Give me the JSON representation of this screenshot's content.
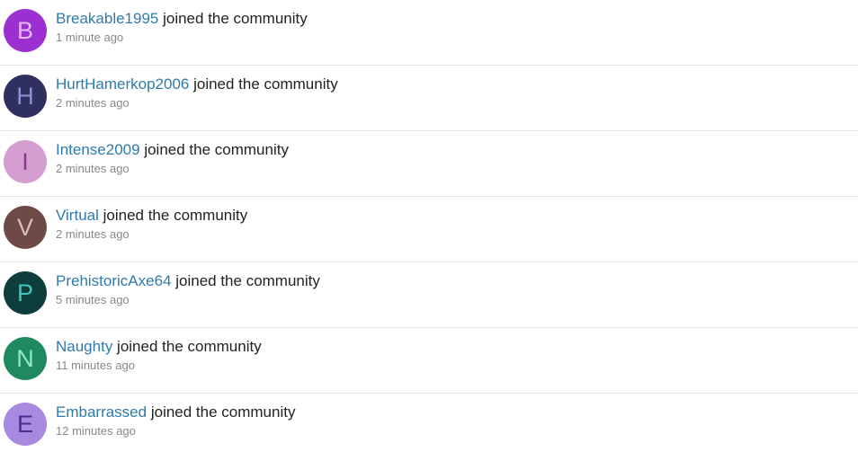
{
  "feed": {
    "items": [
      {
        "initial": "B",
        "username": "Breakable1995",
        "action": " joined the community",
        "time": "1 minute ago",
        "avatar_bg": "#9b2fcf",
        "avatar_fg": "#e2b8f5"
      },
      {
        "initial": "H",
        "username": "HurtHamerkop2006",
        "action": " joined the community",
        "time": "2 minutes ago",
        "avatar_bg": "#2f2f60",
        "avatar_fg": "#8a8fd6"
      },
      {
        "initial": "I",
        "username": "Intense2009",
        "action": " joined the community",
        "time": "2 minutes ago",
        "avatar_bg": "#d49ed0",
        "avatar_fg": "#8a3a87"
      },
      {
        "initial": "V",
        "username": "Virtual",
        "action": " joined the community",
        "time": "2 minutes ago",
        "avatar_bg": "#6e4a47",
        "avatar_fg": "#d2bdb9"
      },
      {
        "initial": "P",
        "username": "PrehistoricAxe64",
        "action": " joined the community",
        "time": "5 minutes ago",
        "avatar_bg": "#0d3e3c",
        "avatar_fg": "#3fc7c0"
      },
      {
        "initial": "N",
        "username": "Naughty",
        "action": " joined the community",
        "time": "11 minutes ago",
        "avatar_bg": "#1f8a5f",
        "avatar_fg": "#8de8c2"
      },
      {
        "initial": "E",
        "username": "Embarrassed",
        "action": " joined the community",
        "time": "12 minutes ago",
        "avatar_bg": "#a78ae0",
        "avatar_fg": "#4b2a96"
      }
    ]
  }
}
